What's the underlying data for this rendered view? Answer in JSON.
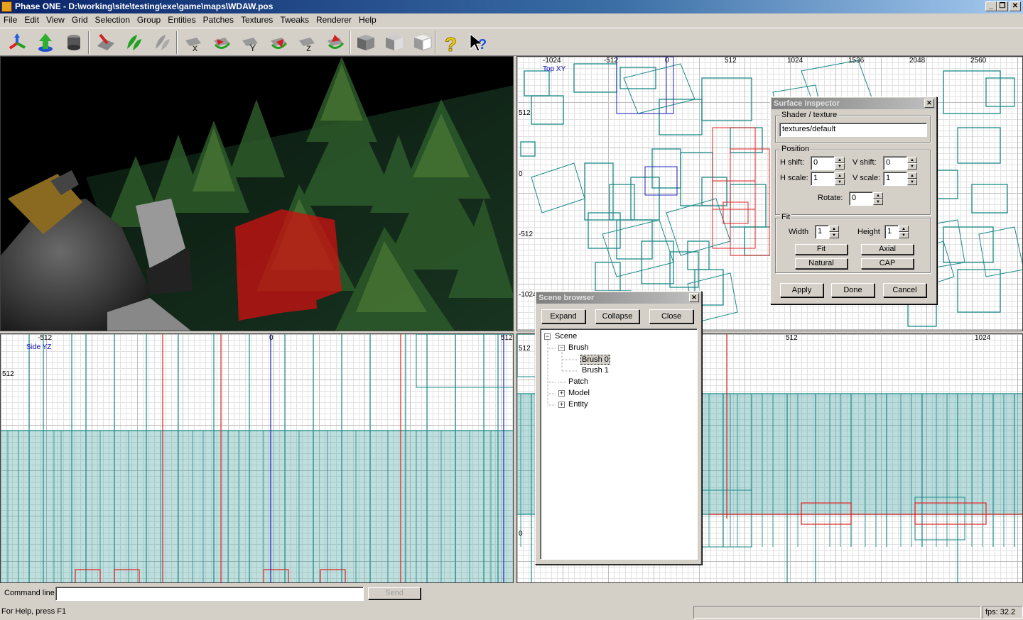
{
  "window": {
    "title": "Phase ONE - D:\\working\\site\\testing\\exe\\game\\maps\\WDAW.pos",
    "minimize": "_",
    "restore": "❐",
    "close": "✕"
  },
  "menu": [
    "File",
    "Edit",
    "View",
    "Grid",
    "Selection",
    "Group",
    "Entities",
    "Patches",
    "Textures",
    "Tweaks",
    "Renderer",
    "Help"
  ],
  "toolbar": {
    "icons": [
      "axis-gizmo-icon",
      "up-arrow-icon",
      "drum-icon",
      "paint-brush-icon",
      "green-leaves-icon",
      "grey-leaves-icon",
      "flip-x-icon",
      "rotate-x-icon",
      "flip-y-icon",
      "rotate-y-icon",
      "flip-z-icon",
      "rotate-z-icon",
      "cube-dark-icon",
      "cube-light-icon",
      "cube-white-icon",
      "help-icon",
      "context-help-icon"
    ]
  },
  "viewports": {
    "top": {
      "name": "Top XY",
      "x_ticks": [
        "-1024",
        "-512",
        "0",
        "512",
        "1024",
        "1536",
        "2048",
        "2560"
      ],
      "y_ticks": [
        "512",
        "0",
        "-512",
        "-1024"
      ]
    },
    "side": {
      "name": "Side YZ",
      "x_ticks": [
        "-512",
        "0",
        "512"
      ],
      "y_ticks": [
        "512"
      ]
    },
    "front": {
      "x_ticks": [
        "512",
        "1024"
      ],
      "y_ticks": [
        "512",
        "0"
      ]
    }
  },
  "surface_inspector": {
    "title": "Surface inspector",
    "close": "✕",
    "shader_group": "Shader / texture",
    "shader_value": "textures/default",
    "position_group": "Position",
    "h_shift_label": "H shift:",
    "h_shift_value": "0",
    "v_shift_label": "V shift:",
    "v_shift_value": "0",
    "h_scale_label": "H scale:",
    "h_scale_value": "1",
    "v_scale_label": "V scale:",
    "v_scale_value": "1",
    "rotate_label": "Rotate:",
    "rotate_value": "0",
    "fit_group": "Fit",
    "width_label": "Width",
    "width_value": "1",
    "height_label": "Height",
    "height_value": "1",
    "fit_button": "Fit",
    "axial_button": "Axial",
    "natural_button": "Natural",
    "cap_button": "CAP",
    "apply_button": "Apply",
    "done_button": "Done",
    "cancel_button": "Cancel"
  },
  "scene_browser": {
    "title": "Scene browser",
    "close": "✕",
    "expand_button": "Expand",
    "collapse_button": "Collapse",
    "close_button": "Close",
    "tree": {
      "scene": "Scene",
      "brush": "Brush",
      "brush0": "Brush 0",
      "brush1": "Brush 1",
      "patch": "Patch",
      "model": "Model",
      "entity": "Entity"
    }
  },
  "command": {
    "label": "Command line:",
    "value": "",
    "send_button": "Send"
  },
  "status": {
    "help": "For Help, press F1",
    "fps": "fps: 32.2"
  },
  "colors": {
    "brush": "#1a8a8a",
    "selected": "#e02020",
    "titlebar": "#0a246a"
  }
}
